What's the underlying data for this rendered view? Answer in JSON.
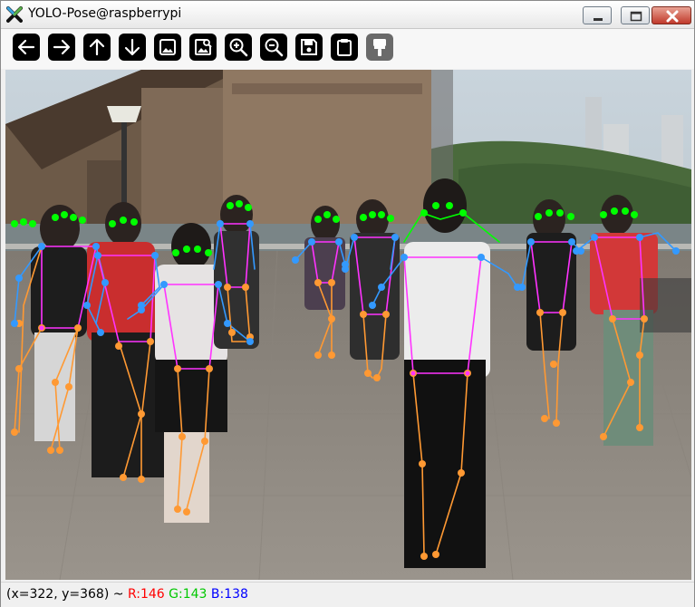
{
  "window": {
    "title": "YOLO-Pose@raspberrypi",
    "app_icon": "x-logo-icon"
  },
  "window_buttons": [
    "minimize",
    "maximize",
    "close"
  ],
  "toolbar": {
    "buttons": [
      {
        "name": "pan-left-button",
        "icon": "arrow-left-icon"
      },
      {
        "name": "pan-right-button",
        "icon": "arrow-right-icon"
      },
      {
        "name": "pan-up-button",
        "icon": "arrow-up-icon"
      },
      {
        "name": "pan-down-button",
        "icon": "arrow-down-icon"
      },
      {
        "name": "zoom-to-fit-button",
        "icon": "image-icon"
      },
      {
        "name": "zoom-original-button",
        "icon": "image-search-icon"
      },
      {
        "name": "zoom-in-button",
        "icon": "zoom-in-icon"
      },
      {
        "name": "zoom-out-button",
        "icon": "zoom-out-icon"
      },
      {
        "name": "save-button",
        "icon": "save-icon"
      },
      {
        "name": "copy-button",
        "icon": "clipboard-icon"
      },
      {
        "name": "properties-button",
        "icon": "brush-icon",
        "disabled": true
      }
    ]
  },
  "status": {
    "coords": "(x=322, y=368) ~ ",
    "r": "R:146",
    "g": "G:143",
    "b": "B:138"
  },
  "colors": {
    "skeleton_limb": "#ff9933",
    "skeleton_torso": "#ff33ff",
    "skeleton_arm": "#3399ff",
    "skeleton_face": "#00ff00",
    "status_r": "#ff0000",
    "status_g": "#00c800",
    "status_b": "#0000ff"
  }
}
